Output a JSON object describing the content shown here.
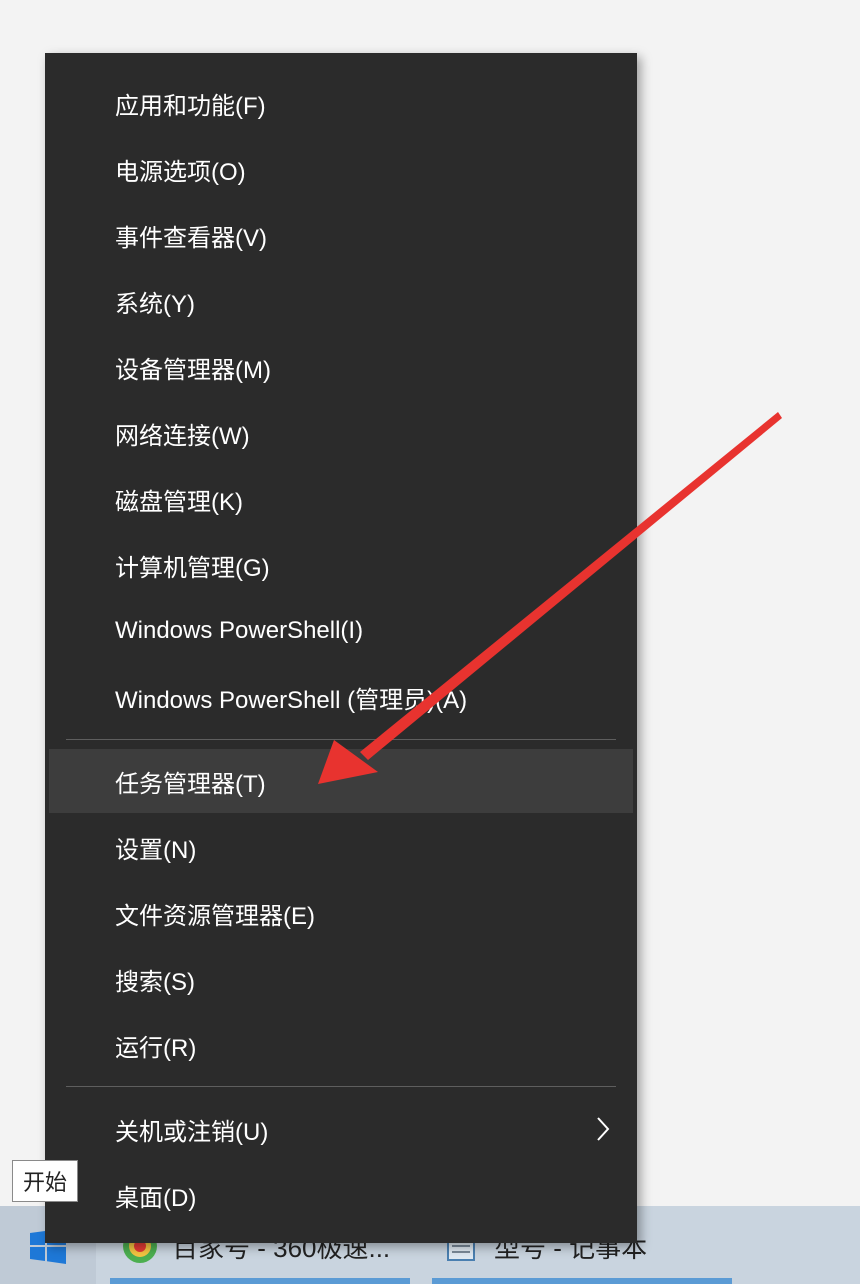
{
  "menu": {
    "items": [
      {
        "label": "应用和功能(F)"
      },
      {
        "label": "电源选项(O)"
      },
      {
        "label": "事件查看器(V)"
      },
      {
        "label": "系统(Y)"
      },
      {
        "label": "设备管理器(M)"
      },
      {
        "label": "网络连接(W)"
      },
      {
        "label": "磁盘管理(K)"
      },
      {
        "label": "计算机管理(G)"
      },
      {
        "label": "Windows PowerShell(I)"
      },
      {
        "label": "Windows PowerShell (管理员)(A)"
      },
      {
        "label": "任务管理器(T)",
        "highlighted": true
      },
      {
        "label": "设置(N)"
      },
      {
        "label": "文件资源管理器(E)"
      },
      {
        "label": "搜索(S)"
      },
      {
        "label": "运行(R)"
      },
      {
        "label": "关机或注销(U)",
        "has_submenu": true
      },
      {
        "label": "桌面(D)"
      }
    ]
  },
  "tooltip": {
    "text": "开始"
  },
  "taskbar": {
    "items": [
      {
        "label": "百家号 - 360极速...",
        "icon": "browser-icon"
      },
      {
        "label": "型号 - 记事本",
        "icon": "notepad-icon"
      }
    ]
  },
  "colors": {
    "menu_bg": "#2b2b2b",
    "menu_hover": "#3d3d3d",
    "menu_text": "#ffffff",
    "annotation_arrow": "#e8332f",
    "taskbar_bg": "#c9d4df",
    "windows_blue": "#1e78d7"
  }
}
